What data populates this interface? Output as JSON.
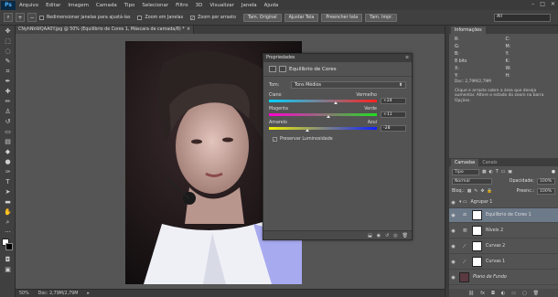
{
  "menu": [
    "Arquivo",
    "Editar",
    "Imagem",
    "Camada",
    "Tipo",
    "Selecionar",
    "Filtro",
    "3D",
    "Visualizar",
    "Janela",
    "Ajuda"
  ],
  "app_logo": "Ps",
  "options_bar": {
    "resize_windows_label": "Redimensionar janelas para ajustá-las",
    "zoom_all_label": "Zoom em Janelas",
    "scrubby_zoom_label": "Zoom por arrasto",
    "btn_original": "Tam. Original",
    "btn_fit": "Ajustar Tela",
    "btn_fill": "Preencher tela",
    "btn_print": "Tam. Impr.",
    "workspace": "All"
  },
  "document": {
    "tab_title": "CNyhNkWQAA0Y.jpg @ 50% (Equilíbrio de Cores 1, Máscara de camada/8) *",
    "zoom": "50%",
    "doc_info": "Doc: 2,79M/2,79M"
  },
  "properties": {
    "header": "Propriedades",
    "title": "Equilíbrio de Cores",
    "tone_label": "Tom:",
    "tone_value": "Tons Médios",
    "sliders": [
      {
        "left": "Ciano",
        "right": "Vermelho",
        "value": "+24",
        "pos": 0.62,
        "gradient": "linear-gradient(to right, #00d5ff, #ff2020)"
      },
      {
        "left": "Magenta",
        "right": "Verde",
        "value": "+11",
        "pos": 0.55,
        "gradient": "linear-gradient(to right, #ff00d0, #20e020)"
      },
      {
        "left": "Amarelo",
        "right": "Azul",
        "value": "-28",
        "pos": 0.36,
        "gradient": "linear-gradient(to right, #f0f000, #1020ff)"
      }
    ],
    "preserve_label": "Preservar Luminosidade"
  },
  "info_panel": {
    "tabs": [
      "Informações"
    ],
    "cells": [
      "R:",
      "C:",
      "G:",
      "M:",
      "B:",
      "Y:",
      "8 bits",
      "K:",
      "X:",
      "W:",
      "Y:",
      "H:"
    ],
    "doc": "Doc: 2,79M/2,79M",
    "hint": "Clique e arraste sobre a área que deseja aumentar. Altere o estado do zoom na barra Opções."
  },
  "layers_panel": {
    "tabs": [
      "Camadas",
      "Canais"
    ],
    "filter_label": "Tipo",
    "blend_mode": "Normal",
    "opacity_label": "Opacidade:",
    "opacity": "100%",
    "lock_label": "Bloq.:",
    "fill_label": "Preenc.:",
    "fill": "100%",
    "layers": [
      {
        "name": "Agrupar 1",
        "type": "group"
      },
      {
        "name": "Equilíbrio de Cores 1",
        "type": "adjust",
        "selected": true
      },
      {
        "name": "Níveis 2",
        "type": "adjust"
      },
      {
        "name": "Curvas 2",
        "type": "adjust"
      },
      {
        "name": "Curvas 1",
        "type": "adjust"
      },
      {
        "name": "Plano de Fundo",
        "type": "image"
      }
    ]
  },
  "colors": {
    "chrome": "#535353",
    "panel_dark": "#3d3d3d",
    "selected_layer": "#6d7a8a",
    "ps_blue": "#4fb3ff"
  }
}
